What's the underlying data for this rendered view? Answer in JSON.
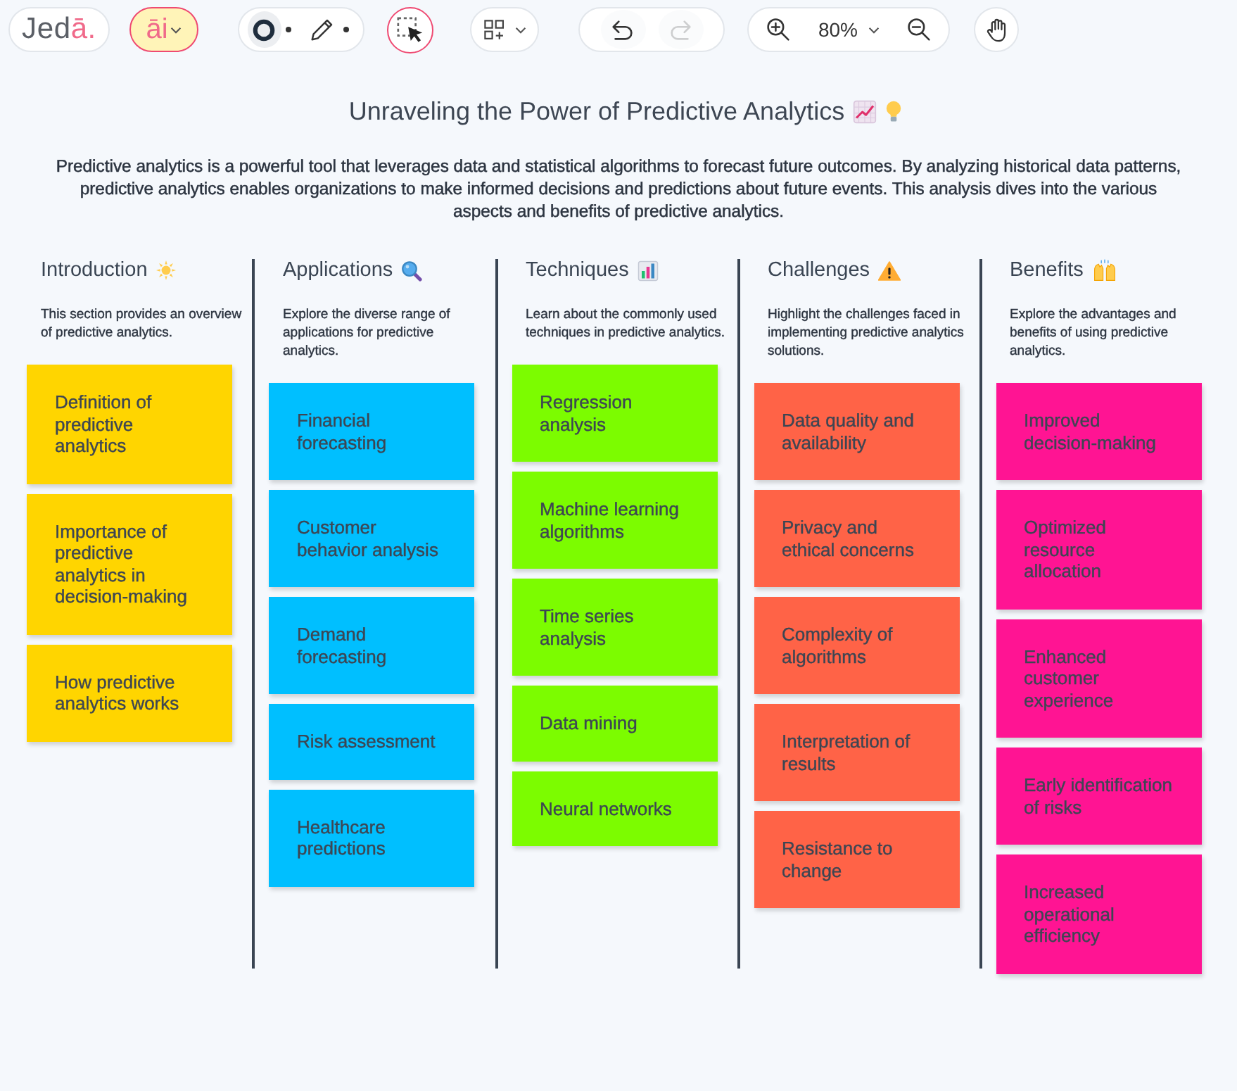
{
  "toolbar": {
    "logo": {
      "text": "Jed",
      "accent": "ā."
    },
    "ai_button": "āi",
    "undo": {
      "disabled": false
    },
    "redo": {
      "disabled": true
    },
    "zoom_level": "80%"
  },
  "board": {
    "title": "Unraveling the Power of Predictive Analytics",
    "description": "Predictive analytics is a powerful tool that leverages data and statistical algorithms to forecast future outcomes. By analyzing historical data patterns, predictive analytics enables organizations to make informed decisions and predictions about future events. This analysis dives into the various aspects and benefits of predictive analytics.",
    "columns": [
      {
        "heading": "Introduction",
        "description": "This section provides an overview of predictive analytics.",
        "color": "#ffd500",
        "cards": [
          "Definition of predictive analytics",
          "Importance of predictive analytics in decision-making",
          "How predictive analytics works"
        ]
      },
      {
        "heading": "Applications",
        "description": "Explore the diverse range of applications for predictive analytics.",
        "color": "#00bfff",
        "cards": [
          "Financial forecasting",
          "Customer behavior analysis",
          "Demand forecasting",
          "Risk assessment",
          "Healthcare predictions"
        ]
      },
      {
        "heading": "Techniques",
        "description": "Learn about the commonly used techniques in predictive analytics.",
        "color": "#7cfc00",
        "cards": [
          "Regression analysis",
          "Machine learning algorithms",
          "Time series analysis",
          "Data mining",
          "Neural networks"
        ]
      },
      {
        "heading": "Challenges",
        "description": "Highlight the challenges faced in implementing predictive analytics solutions.",
        "color": "#ff6347",
        "cards": [
          "Data quality and availability",
          "Privacy and ethical concerns",
          "Complexity of algorithms",
          "Interpretation of results",
          "Resistance to change"
        ]
      },
      {
        "heading": "Benefits",
        "description": "Explore the advantages and benefits of using predictive analytics.",
        "color": "#ff1493",
        "cards": [
          "Improved decision-making",
          "Optimized resource allocation",
          "Enhanced customer experience",
          "Early identification of risks",
          "Increased operational efficiency"
        ]
      }
    ]
  }
}
